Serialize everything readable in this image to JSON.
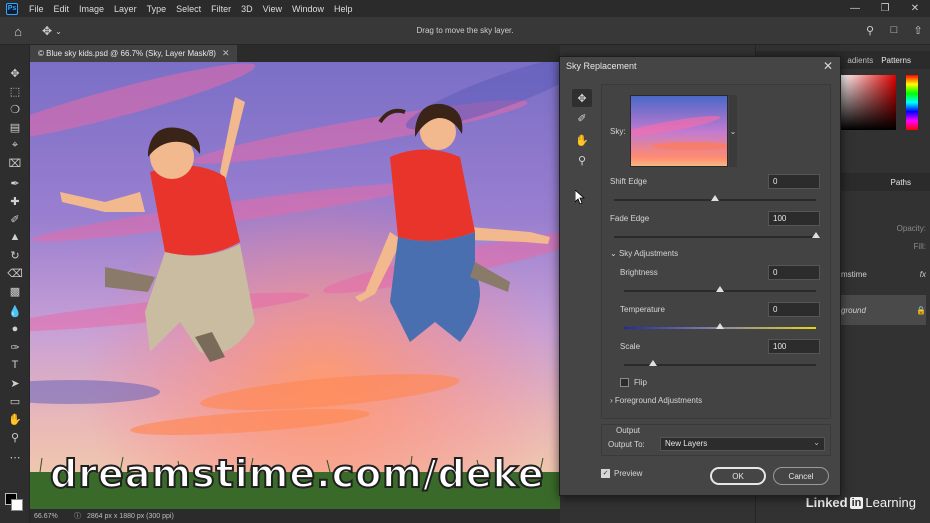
{
  "app": {
    "logo": "Ps"
  },
  "menu": [
    "File",
    "Edit",
    "Image",
    "Layer",
    "Type",
    "Select",
    "Filter",
    "3D",
    "View",
    "Window",
    "Help"
  ],
  "options_bar": {
    "hint": "Drag to move the sky layer."
  },
  "document": {
    "tab_title": "© Blue sky kids.psd @ 66.7% (Sky, Layer Mask/8)",
    "zoom": "66.67%",
    "info": "2864 px x 1880 px (300 ppi)",
    "watermark": "dreamstime.com/deke"
  },
  "panels": {
    "color_tabs": [
      "adients",
      "Patterns"
    ],
    "layers_tabs": [
      "Paths"
    ],
    "opacity_label": "Opacity:",
    "fill_label": "Fill:",
    "layer_1": "mstime",
    "layer_1_fx": "fx",
    "layer_2": "ground",
    "branding_1": "Linked",
    "branding_in": "in",
    "branding_2": "Learning"
  },
  "dialog": {
    "title": "Sky Replacement",
    "sky_label": "Sky:",
    "shift_edge": {
      "label": "Shift Edge",
      "value": "0",
      "fraction": 0.5
    },
    "fade_edge": {
      "label": "Fade Edge",
      "value": "100",
      "fraction": 1.0
    },
    "sky_adjustments": "Sky Adjustments",
    "brightness": {
      "label": "Brightness",
      "value": "0",
      "fraction": 0.5
    },
    "temperature": {
      "label": "Temperature",
      "value": "0",
      "fraction": 0.5
    },
    "scale": {
      "label": "Scale",
      "value": "100",
      "fraction": 0.15
    },
    "flip": "Flip",
    "foreground_adjustments": "Foreground Adjustments",
    "output_section": "Output",
    "output_to_label": "Output To:",
    "output_to_value": "New Layers",
    "preview": "Preview",
    "ok": "OK",
    "cancel": "Cancel"
  },
  "colors": {
    "accent": "#31a8ff",
    "foreground": "#000000",
    "background": "#ffffff"
  }
}
